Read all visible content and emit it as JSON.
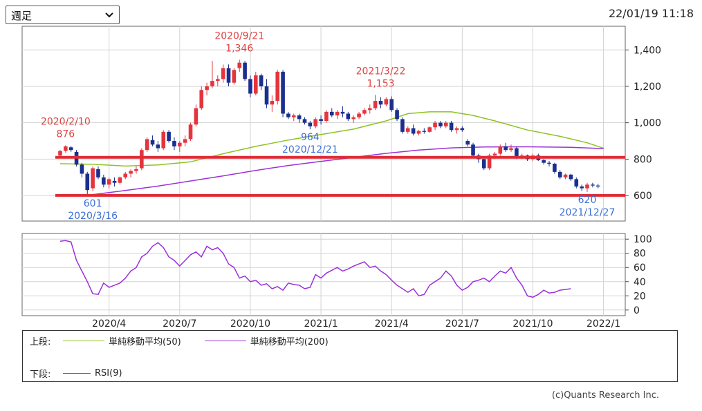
{
  "header": {
    "period_select": {
      "value": "週足"
    },
    "timestamp": "22/01/19 11:18"
  },
  "colors": {
    "up": "#e4353e",
    "down": "#1b2f8f",
    "sma50": "#8dc21f",
    "sma200": "#9b30d9",
    "rsi": "#9b30d9",
    "support_line": "#e02b35",
    "annotation_high": "#e04343",
    "annotation_low": "#3b6fd6",
    "grid": "#d3d3d3"
  },
  "chart_data": [
    {
      "type": "candlestick",
      "panel": "upper",
      "y_ticks": [
        "1,400",
        "1,200",
        "1,000",
        "800",
        "600"
      ],
      "y_tick_values": [
        1400,
        1200,
        1000,
        800,
        600
      ],
      "ylim": [
        460,
        1530
      ],
      "x_tick_labels": [
        "2020/4",
        "2020/7",
        "2020/10",
        "2021/1",
        "2021/4",
        "2021/7",
        "2021/10",
        "2022/1"
      ],
      "x_tick_weeks": [
        9,
        22,
        35,
        48,
        61,
        74,
        87,
        100
      ],
      "x_range_weeks": [
        -7,
        104
      ],
      "horizontal_lines": [
        810,
        601
      ],
      "annotations": [
        {
          "label_top": "2020/2/10",
          "label_bottom": "876",
          "week": 1,
          "value": 876,
          "kind": "high"
        },
        {
          "label_top": "601",
          "label_bottom": "2020/3/16",
          "week": 6,
          "value": 601,
          "kind": "low"
        },
        {
          "label_top": "2020/9/21",
          "label_bottom": "1,346",
          "week": 33,
          "value": 1346,
          "kind": "high"
        },
        {
          "label_top": "964",
          "label_bottom": "2020/12/21",
          "week": 46,
          "value": 964,
          "kind": "low"
        },
        {
          "label_top": "2021/3/22",
          "label_bottom": "1,153",
          "week": 59,
          "value": 1153,
          "kind": "high"
        },
        {
          "label_top": "620",
          "label_bottom": "2021/12/27",
          "week": 97,
          "value": 620,
          "kind": "low"
        }
      ],
      "candles": [
        {
          "o": 820,
          "h": 850,
          "l": 810,
          "c": 845
        },
        {
          "o": 845,
          "h": 876,
          "l": 835,
          "c": 870
        },
        {
          "o": 865,
          "h": 872,
          "l": 840,
          "c": 850
        },
        {
          "o": 840,
          "h": 850,
          "l": 760,
          "c": 770
        },
        {
          "o": 770,
          "h": 780,
          "l": 700,
          "c": 720
        },
        {
          "o": 720,
          "h": 730,
          "l": 601,
          "c": 630
        },
        {
          "o": 640,
          "h": 760,
          "l": 625,
          "c": 750
        },
        {
          "o": 745,
          "h": 760,
          "l": 690,
          "c": 700
        },
        {
          "o": 700,
          "h": 715,
          "l": 645,
          "c": 660
        },
        {
          "o": 660,
          "h": 700,
          "l": 640,
          "c": 690
        },
        {
          "o": 680,
          "h": 700,
          "l": 650,
          "c": 670
        },
        {
          "o": 670,
          "h": 705,
          "l": 660,
          "c": 700
        },
        {
          "o": 700,
          "h": 730,
          "l": 690,
          "c": 720
        },
        {
          "o": 720,
          "h": 745,
          "l": 700,
          "c": 735
        },
        {
          "o": 735,
          "h": 760,
          "l": 720,
          "c": 745
        },
        {
          "o": 750,
          "h": 860,
          "l": 740,
          "c": 850
        },
        {
          "o": 850,
          "h": 920,
          "l": 840,
          "c": 910
        },
        {
          "o": 905,
          "h": 930,
          "l": 870,
          "c": 880
        },
        {
          "o": 880,
          "h": 900,
          "l": 840,
          "c": 860
        },
        {
          "o": 860,
          "h": 960,
          "l": 850,
          "c": 950
        },
        {
          "o": 950,
          "h": 960,
          "l": 890,
          "c": 900
        },
        {
          "o": 900,
          "h": 920,
          "l": 850,
          "c": 870
        },
        {
          "o": 870,
          "h": 900,
          "l": 840,
          "c": 890
        },
        {
          "o": 890,
          "h": 930,
          "l": 870,
          "c": 910
        },
        {
          "o": 910,
          "h": 1000,
          "l": 900,
          "c": 990
        },
        {
          "o": 990,
          "h": 1100,
          "l": 980,
          "c": 1080
        },
        {
          "o": 1080,
          "h": 1200,
          "l": 1070,
          "c": 1180
        },
        {
          "o": 1180,
          "h": 1220,
          "l": 1150,
          "c": 1200
        },
        {
          "o": 1200,
          "h": 1340,
          "l": 1190,
          "c": 1230
        },
        {
          "o": 1230,
          "h": 1260,
          "l": 1200,
          "c": 1240
        },
        {
          "o": 1240,
          "h": 1320,
          "l": 1220,
          "c": 1300
        },
        {
          "o": 1300,
          "h": 1320,
          "l": 1200,
          "c": 1220
        },
        {
          "o": 1220,
          "h": 1300,
          "l": 1210,
          "c": 1290
        },
        {
          "o": 1300,
          "h": 1346,
          "l": 1280,
          "c": 1330
        },
        {
          "o": 1330,
          "h": 1340,
          "l": 1230,
          "c": 1240
        },
        {
          "o": 1240,
          "h": 1260,
          "l": 1140,
          "c": 1160
        },
        {
          "o": 1160,
          "h": 1280,
          "l": 1150,
          "c": 1260
        },
        {
          "o": 1260,
          "h": 1270,
          "l": 1180,
          "c": 1200
        },
        {
          "o": 1200,
          "h": 1240,
          "l": 1080,
          "c": 1100
        },
        {
          "o": 1100,
          "h": 1150,
          "l": 1060,
          "c": 1120
        },
        {
          "o": 1120,
          "h": 1290,
          "l": 1100,
          "c": 1280
        },
        {
          "o": 1280,
          "h": 1290,
          "l": 1030,
          "c": 1050
        },
        {
          "o": 1050,
          "h": 1060,
          "l": 1020,
          "c": 1030
        },
        {
          "o": 1030,
          "h": 1050,
          "l": 1010,
          "c": 1040
        },
        {
          "o": 1040,
          "h": 1050,
          "l": 1000,
          "c": 1020
        },
        {
          "o": 1020,
          "h": 1030,
          "l": 990,
          "c": 1000
        },
        {
          "o": 1000,
          "h": 1010,
          "l": 964,
          "c": 980
        },
        {
          "o": 980,
          "h": 1030,
          "l": 970,
          "c": 1020
        },
        {
          "o": 1020,
          "h": 1040,
          "l": 990,
          "c": 1010
        },
        {
          "o": 1010,
          "h": 1070,
          "l": 1000,
          "c": 1060
        },
        {
          "o": 1060,
          "h": 1080,
          "l": 1030,
          "c": 1040
        },
        {
          "o": 1040,
          "h": 1070,
          "l": 1020,
          "c": 1060
        },
        {
          "o": 1060,
          "h": 1090,
          "l": 1030,
          "c": 1050
        },
        {
          "o": 1050,
          "h": 1060,
          "l": 1010,
          "c": 1020
        },
        {
          "o": 1020,
          "h": 1040,
          "l": 1000,
          "c": 1030
        },
        {
          "o": 1030,
          "h": 1060,
          "l": 1020,
          "c": 1050
        },
        {
          "o": 1050,
          "h": 1080,
          "l": 1040,
          "c": 1070
        },
        {
          "o": 1070,
          "h": 1100,
          "l": 1050,
          "c": 1080
        },
        {
          "o": 1080,
          "h": 1153,
          "l": 1070,
          "c": 1120
        },
        {
          "o": 1120,
          "h": 1140,
          "l": 1080,
          "c": 1100
        },
        {
          "o": 1100,
          "h": 1140,
          "l": 1090,
          "c": 1130
        },
        {
          "o": 1130,
          "h": 1145,
          "l": 1060,
          "c": 1070
        },
        {
          "o": 1070,
          "h": 1080,
          "l": 1010,
          "c": 1020
        },
        {
          "o": 1020,
          "h": 1030,
          "l": 940,
          "c": 950
        },
        {
          "o": 950,
          "h": 980,
          "l": 940,
          "c": 970
        },
        {
          "o": 970,
          "h": 990,
          "l": 930,
          "c": 940
        },
        {
          "o": 940,
          "h": 960,
          "l": 930,
          "c": 955
        },
        {
          "o": 955,
          "h": 970,
          "l": 940,
          "c": 950
        },
        {
          "o": 950,
          "h": 980,
          "l": 945,
          "c": 975
        },
        {
          "o": 975,
          "h": 1010,
          "l": 960,
          "c": 1000
        },
        {
          "o": 1000,
          "h": 1010,
          "l": 970,
          "c": 980
        },
        {
          "o": 980,
          "h": 1010,
          "l": 970,
          "c": 1000
        },
        {
          "o": 1000,
          "h": 1010,
          "l": 950,
          "c": 960
        },
        {
          "o": 960,
          "h": 980,
          "l": 940,
          "c": 970
        },
        {
          "o": 970,
          "h": 980,
          "l": 950,
          "c": 960
        },
        {
          "o": 900,
          "h": 910,
          "l": 870,
          "c": 880
        },
        {
          "o": 880,
          "h": 890,
          "l": 810,
          "c": 820
        },
        {
          "o": 820,
          "h": 830,
          "l": 780,
          "c": 800
        },
        {
          "o": 800,
          "h": 810,
          "l": 740,
          "c": 750
        },
        {
          "o": 750,
          "h": 830,
          "l": 740,
          "c": 820
        },
        {
          "o": 820,
          "h": 840,
          "l": 800,
          "c": 830
        },
        {
          "o": 830,
          "h": 880,
          "l": 820,
          "c": 870
        },
        {
          "o": 870,
          "h": 890,
          "l": 840,
          "c": 850
        },
        {
          "o": 850,
          "h": 880,
          "l": 840,
          "c": 860
        },
        {
          "o": 860,
          "h": 870,
          "l": 800,
          "c": 810
        },
        {
          "o": 810,
          "h": 830,
          "l": 800,
          "c": 820
        },
        {
          "o": 820,
          "h": 825,
          "l": 790,
          "c": 800
        },
        {
          "o": 800,
          "h": 830,
          "l": 790,
          "c": 820
        },
        {
          "o": 820,
          "h": 830,
          "l": 790,
          "c": 795
        },
        {
          "o": 795,
          "h": 800,
          "l": 770,
          "c": 780
        },
        {
          "o": 780,
          "h": 790,
          "l": 760,
          "c": 775
        },
        {
          "o": 775,
          "h": 780,
          "l": 720,
          "c": 730
        },
        {
          "o": 730,
          "h": 740,
          "l": 690,
          "c": 700
        },
        {
          "o": 700,
          "h": 720,
          "l": 690,
          "c": 715
        },
        {
          "o": 715,
          "h": 720,
          "l": 680,
          "c": 690
        },
        {
          "o": 690,
          "h": 700,
          "l": 640,
          "c": 650
        },
        {
          "o": 650,
          "h": 660,
          "l": 625,
          "c": 640
        },
        {
          "o": 640,
          "h": 670,
          "l": 620,
          "c": 660
        },
        {
          "o": 660,
          "h": 670,
          "l": 645,
          "c": 655
        },
        {
          "o": 655,
          "h": 665,
          "l": 640,
          "c": 650
        }
      ],
      "sma50": [
        [
          0,
          775
        ],
        [
          6,
          772
        ],
        [
          12,
          762
        ],
        [
          18,
          768
        ],
        [
          24,
          785
        ],
        [
          30,
          830
        ],
        [
          36,
          870
        ],
        [
          42,
          905
        ],
        [
          48,
          935
        ],
        [
          54,
          965
        ],
        [
          60,
          1010
        ],
        [
          64,
          1050
        ],
        [
          68,
          1060
        ],
        [
          72,
          1060
        ],
        [
          76,
          1040
        ],
        [
          80,
          1010
        ],
        [
          86,
          960
        ],
        [
          92,
          925
        ],
        [
          97,
          890
        ],
        [
          100,
          860
        ]
      ],
      "sma200": [
        [
          6,
          605
        ],
        [
          12,
          628
        ],
        [
          18,
          652
        ],
        [
          24,
          680
        ],
        [
          30,
          708
        ],
        [
          36,
          738
        ],
        [
          42,
          765
        ],
        [
          48,
          788
        ],
        [
          54,
          810
        ],
        [
          60,
          832
        ],
        [
          66,
          850
        ],
        [
          72,
          862
        ],
        [
          78,
          867
        ],
        [
          86,
          868
        ],
        [
          94,
          865
        ],
        [
          100,
          858
        ]
      ]
    },
    {
      "type": "line",
      "panel": "lower",
      "name": "RSI(9)",
      "y_ticks": [
        "100",
        "80",
        "60",
        "40",
        "20",
        "0"
      ],
      "y_tick_values": [
        100,
        80,
        60,
        40,
        20,
        0
      ],
      "ylim": [
        -8,
        108
      ],
      "x_range_weeks": [
        -7,
        104
      ],
      "values": [
        97,
        98,
        96,
        70,
        55,
        40,
        23,
        22,
        38,
        32,
        35,
        38,
        45,
        55,
        60,
        75,
        80,
        90,
        95,
        88,
        75,
        70,
        62,
        70,
        78,
        82,
        75,
        90,
        85,
        88,
        80,
        65,
        60,
        45,
        48,
        40,
        42,
        35,
        37,
        30,
        33,
        28,
        38,
        36,
        35,
        30,
        32,
        50,
        45,
        52,
        56,
        60,
        55,
        58,
        62,
        65,
        68,
        60,
        62,
        55,
        50,
        42,
        35,
        30,
        25,
        30,
        20,
        22,
        35,
        40,
        45,
        55,
        48,
        35,
        28,
        32,
        40,
        42,
        45,
        40,
        48,
        55,
        52,
        60,
        45,
        35,
        20,
        18,
        22,
        28,
        24,
        25,
        28,
        29,
        30
      ]
    }
  ],
  "legend": {
    "upper_label": "上段:",
    "lower_label": "下段:",
    "items_upper": [
      {
        "name": "単純移動平均(50)",
        "color": "#8dc21f"
      },
      {
        "name": "単純移動平均(200)",
        "color": "#9b30d9"
      }
    ],
    "items_lower": [
      {
        "name": "RSI(9)",
        "color": "#9b30d9"
      }
    ]
  },
  "footer": {
    "copyright": "(c)Quants Research Inc."
  }
}
